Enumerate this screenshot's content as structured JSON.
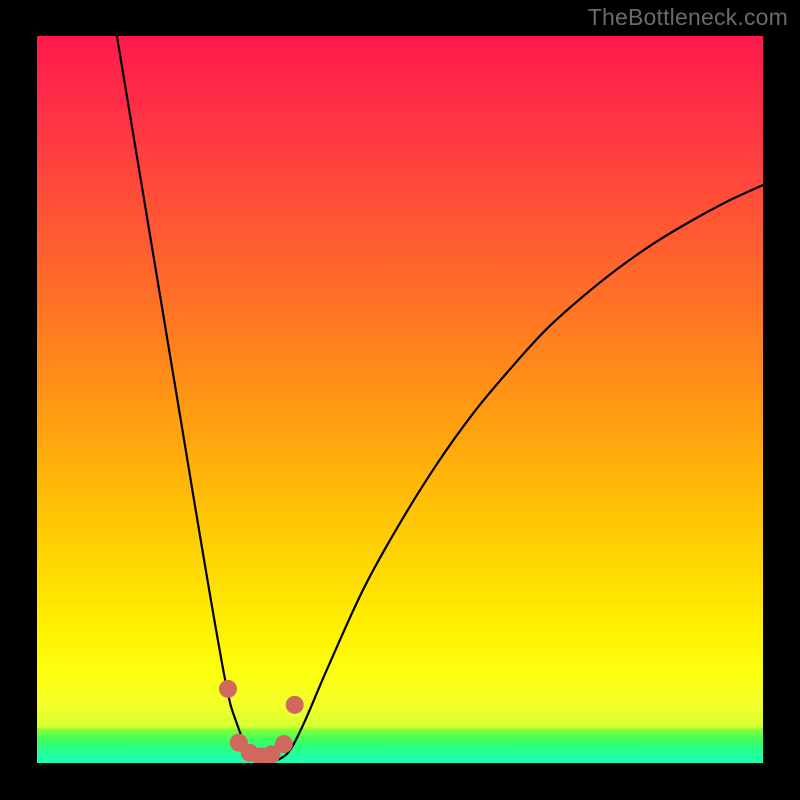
{
  "watermark": "TheBottleneck.com",
  "chart_data": {
    "type": "line",
    "title": "",
    "xlabel": "",
    "ylabel": "",
    "xlim": [
      0,
      100
    ],
    "ylim": [
      0,
      100
    ],
    "grid": false,
    "legend": false,
    "notes": "Bottleneck-style curve: steep descent from top-left to a flat trough near x≈28–34 (y≈0–3), then a concave rise toward the upper right. Background is a vertical rainbow gradient (red at top through yellow to green at bottom). Seven salmon dots mark the trough.",
    "series": [
      {
        "name": "bottleneck-curve",
        "x": [
          11.0,
          14.0,
          17.0,
          20.0,
          23.0,
          26.0,
          27.5,
          29.0,
          30.5,
          32.0,
          33.5,
          35.0,
          37.0,
          40.0,
          45.0,
          50.0,
          55.0,
          60.0,
          65.0,
          70.0,
          75.0,
          80.0,
          85.0,
          90.0,
          95.0,
          100.0
        ],
        "y": [
          100.0,
          82.0,
          64.0,
          46.0,
          28.0,
          11.0,
          5.5,
          2.0,
          0.5,
          0.3,
          0.6,
          2.0,
          6.0,
          13.0,
          24.0,
          33.0,
          41.0,
          48.0,
          54.0,
          59.5,
          64.0,
          68.0,
          71.5,
          74.5,
          77.2,
          79.5
        ]
      }
    ],
    "trough_markers": {
      "color": "#d1685e",
      "radius_px": 9,
      "points_xy": [
        [
          26.3,
          10.2
        ],
        [
          27.8,
          2.8
        ],
        [
          29.3,
          1.4
        ],
        [
          30.8,
          0.9
        ],
        [
          32.3,
          1.2
        ],
        [
          34.0,
          2.6
        ],
        [
          35.5,
          8.0
        ]
      ]
    },
    "background_gradient": {
      "direction": "top-to-bottom",
      "stops": [
        {
          "pos": 0.0,
          "color": "#ff1a4d"
        },
        {
          "pos": 0.4,
          "color": "#ff7a22"
        },
        {
          "pos": 0.82,
          "color": "#fff200"
        },
        {
          "pos": 0.95,
          "color": "#9fff34"
        },
        {
          "pos": 1.0,
          "color": "#1cffb4"
        }
      ]
    }
  }
}
